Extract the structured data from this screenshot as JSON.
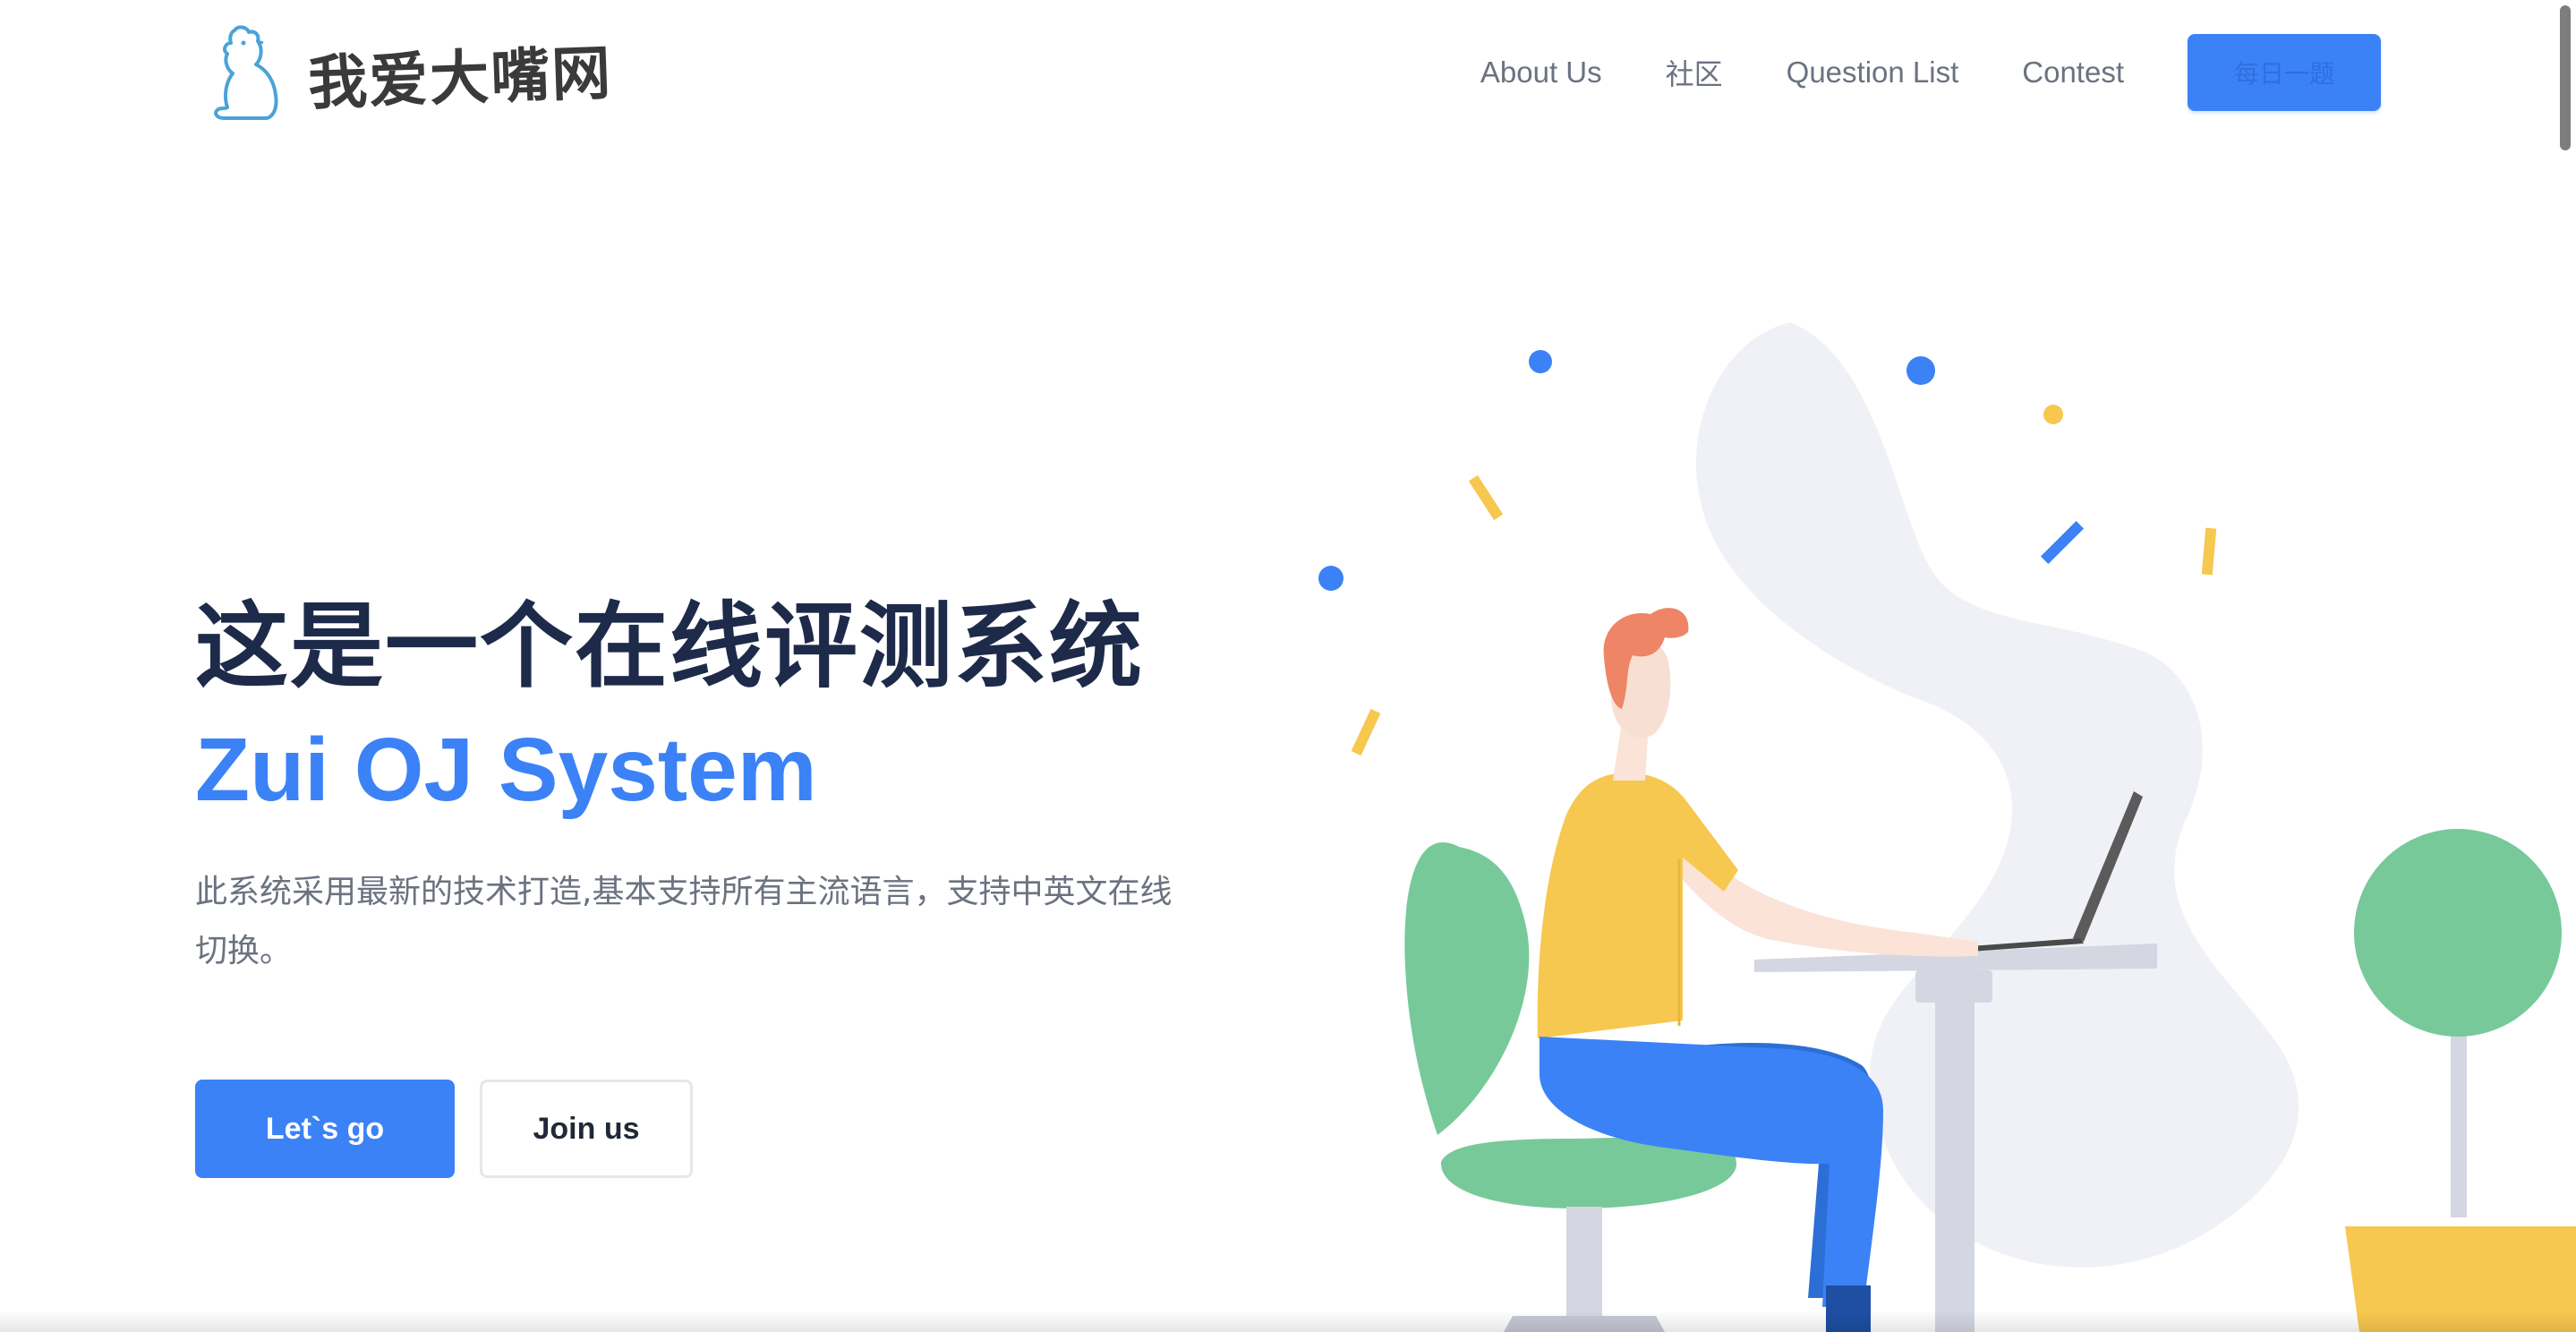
{
  "header": {
    "logo_text": "我爱大嘴网",
    "nav": [
      {
        "label": "About Us"
      },
      {
        "label": "社区"
      },
      {
        "label": "Question List"
      },
      {
        "label": "Contest"
      }
    ],
    "daily_button_label": "每日一题"
  },
  "hero": {
    "title_cn": "这是一个在线评测系统",
    "title_en": "Zui OJ System",
    "description": "此系统采用最新的技术打造,基本支持所有主流语言，支持中英文在线切换。",
    "primary_button": "Let`s go",
    "secondary_button": "Join us"
  },
  "colors": {
    "accent": "#3b82f6",
    "title_dark": "#1e2a4a",
    "text_gray": "#6b7280",
    "illustration_yellow": "#f6c84f",
    "illustration_green": "#77c99a",
    "illustration_blob": "#f0f1f6"
  }
}
